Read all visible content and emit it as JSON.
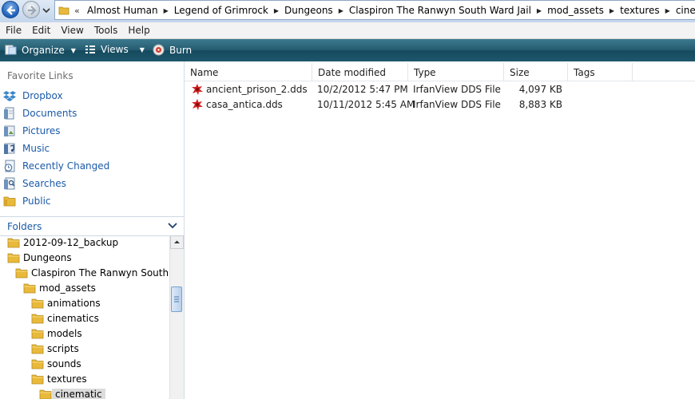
{
  "address": {
    "crumbs": [
      "Almost Human",
      "Legend of Grimrock",
      "Dungeons",
      "Claspiron  The Ranwyn South Ward Jail",
      "mod_assets",
      "textures",
      "cinematic"
    ]
  },
  "menu": [
    "File",
    "Edit",
    "View",
    "Tools",
    "Help"
  ],
  "commands": {
    "organize": "Organize",
    "views": "Views",
    "burn": "Burn"
  },
  "favorites": {
    "title": "Favorite Links",
    "items": [
      {
        "label": "Dropbox",
        "icon": "dropbox-icon"
      },
      {
        "label": "Documents",
        "icon": "documents-icon"
      },
      {
        "label": "Pictures",
        "icon": "pictures-icon"
      },
      {
        "label": "Music",
        "icon": "music-icon"
      },
      {
        "label": "Recently Changed",
        "icon": "recently-changed-icon"
      },
      {
        "label": "Searches",
        "icon": "searches-icon"
      },
      {
        "label": "Public",
        "icon": "public-folder-icon"
      }
    ]
  },
  "folders": {
    "title": "Folders",
    "tree": [
      {
        "label": "2012-09-12_backup",
        "depth": 0
      },
      {
        "label": "Dungeons",
        "depth": 0
      },
      {
        "label": "Claspiron  The Ranwyn South Wa",
        "depth": 1
      },
      {
        "label": "mod_assets",
        "depth": 2
      },
      {
        "label": "animations",
        "depth": 3
      },
      {
        "label": "cinematics",
        "depth": 3
      },
      {
        "label": "models",
        "depth": 3
      },
      {
        "label": "scripts",
        "depth": 3
      },
      {
        "label": "sounds",
        "depth": 3
      },
      {
        "label": "textures",
        "depth": 3
      },
      {
        "label": "cinematic",
        "depth": 4,
        "selected": true
      }
    ]
  },
  "columns": [
    "Name",
    "Date modified",
    "Type",
    "Size",
    "Tags"
  ],
  "files": [
    {
      "name": "ancient_prison_2.dds",
      "date": "10/2/2012 5:47 PM",
      "type": "IrfanView DDS File",
      "size": "4,097 KB",
      "tags": ""
    },
    {
      "name": "casa_antica.dds",
      "date": "10/11/2012 5:45 AM",
      "type": "IrfanView DDS File",
      "size": "8,883 KB",
      "tags": ""
    }
  ],
  "colors": {
    "link_blue": "#1b5aa8",
    "command_bar": "#245b71",
    "folder_yellow": "#e9b93b"
  }
}
